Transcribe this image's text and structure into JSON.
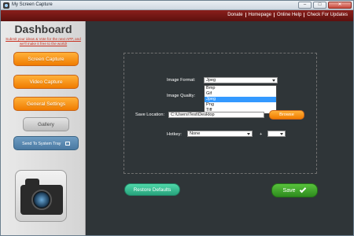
{
  "window": {
    "title": "My Screen Capture",
    "controls": [
      "–",
      "□",
      "✕"
    ]
  },
  "toplinks": [
    "Donate",
    "Homepage",
    "Online Help",
    "Check For Updates"
  ],
  "sidebar": {
    "title": "Dashboard",
    "submit_text": "Submit your ideas & Vote for the next APP, and we'll make it free to the world!",
    "buttons": {
      "screen_capture": "Screen Capture",
      "video_capture": "Video Capture",
      "general_settings": "General Settings",
      "gallery": "Gallery",
      "send_to_tray": "Send To System Tray"
    }
  },
  "form": {
    "image_format_label": "Image Format:",
    "image_format_value": "Jpeg",
    "image_format_options": [
      "Bmp",
      "Gif",
      "Jpeg",
      "Png",
      "Tiff"
    ],
    "image_format_selected": "Jpeg",
    "image_quality_label": "Image Quality:",
    "save_location_label": "Save Location:",
    "save_location_value": "C:\\Users\\Test\\Desktop",
    "browse_label": "Browse",
    "hotkey_label": "Hotkey:",
    "hotkey_value": "None",
    "hotkey_plus": "+",
    "hotkey_key_value": ""
  },
  "actions": {
    "restore": "Restore Defaults",
    "save": "Save"
  },
  "colors": {
    "accent_orange": "#f07c00",
    "topbar_red": "#8a1f1c",
    "save_green": "#2e8b1e",
    "restore_teal": "#27a27c",
    "selection_blue": "#3399ff"
  }
}
